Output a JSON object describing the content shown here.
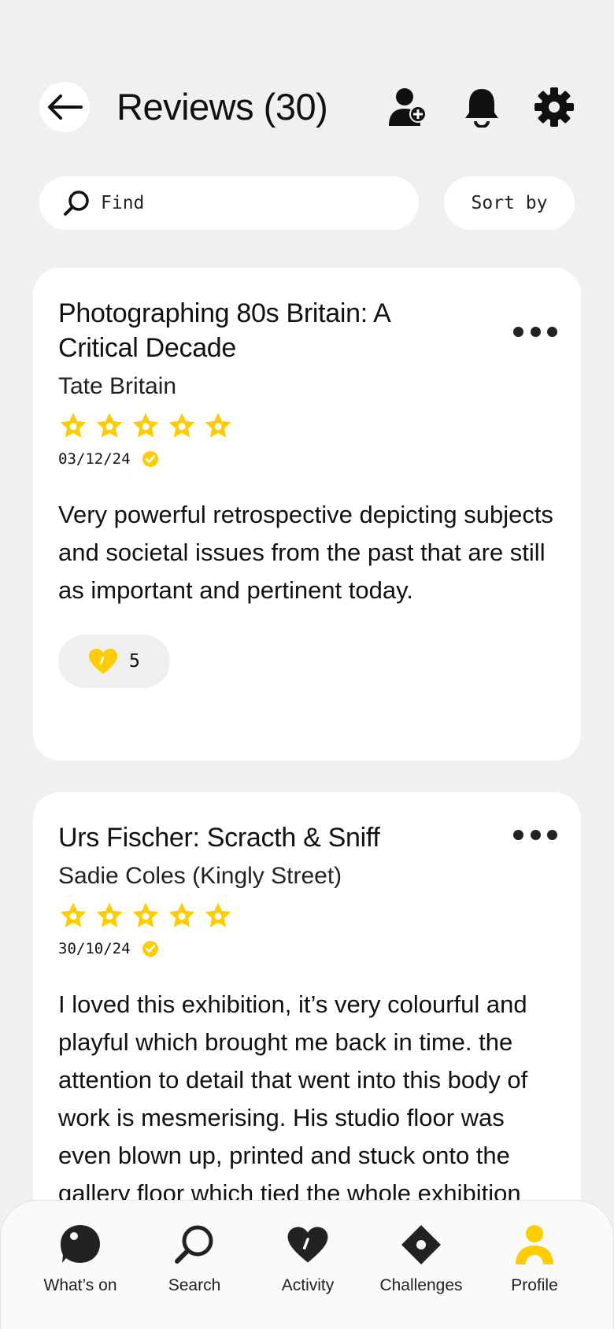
{
  "header": {
    "title": "Reviews (30)"
  },
  "search": {
    "placeholder": "Find",
    "sort_label": "Sort by"
  },
  "colors": {
    "accent": "#ffcc00",
    "background": "#f0f0f0",
    "card": "#ffffff",
    "icon": "#222222"
  },
  "icons": {
    "back": "arrow-left-icon",
    "add_user": "add-user-icon",
    "notifications": "bell-icon",
    "settings": "gear-icon",
    "search": "search-icon",
    "more": "ellipsis-icon",
    "verified": "check-badge-icon",
    "like": "heart-icon"
  },
  "reviews": [
    {
      "title": "Photographing 80s Britain: A Critical Decade",
      "venue": "Tate Britain",
      "rating": 5,
      "rating_max": 5,
      "date": "03/12/24",
      "verified": true,
      "text": "Very powerful retrospective depicting subjects and societal issues from the past that are still as important and pertinent today.",
      "likes": "5"
    },
    {
      "title": "Urs Fischer: Scracth & Sniff",
      "venue": "Sadie Coles (Kingly Street)",
      "rating": 5,
      "rating_max": 5,
      "date": "30/10/24",
      "verified": true,
      "text": "I loved this exhibition, it’s very colourful and playful which brought me back in time. the attention to detail that went into this body of work is mesmerising. His studio floor was even blown up, printed and stuck onto the gallery floor which tied the whole exhibition"
    }
  ],
  "nav": {
    "items": [
      {
        "label": "What’s on",
        "icon": "bubble-icon",
        "active": false
      },
      {
        "label": "Search",
        "icon": "search-icon",
        "active": false
      },
      {
        "label": "Activity",
        "icon": "heart-icon",
        "active": false
      },
      {
        "label": "Challenges",
        "icon": "diamond-icon",
        "active": false
      },
      {
        "label": "Profile",
        "icon": "person-icon",
        "active": true
      }
    ]
  }
}
